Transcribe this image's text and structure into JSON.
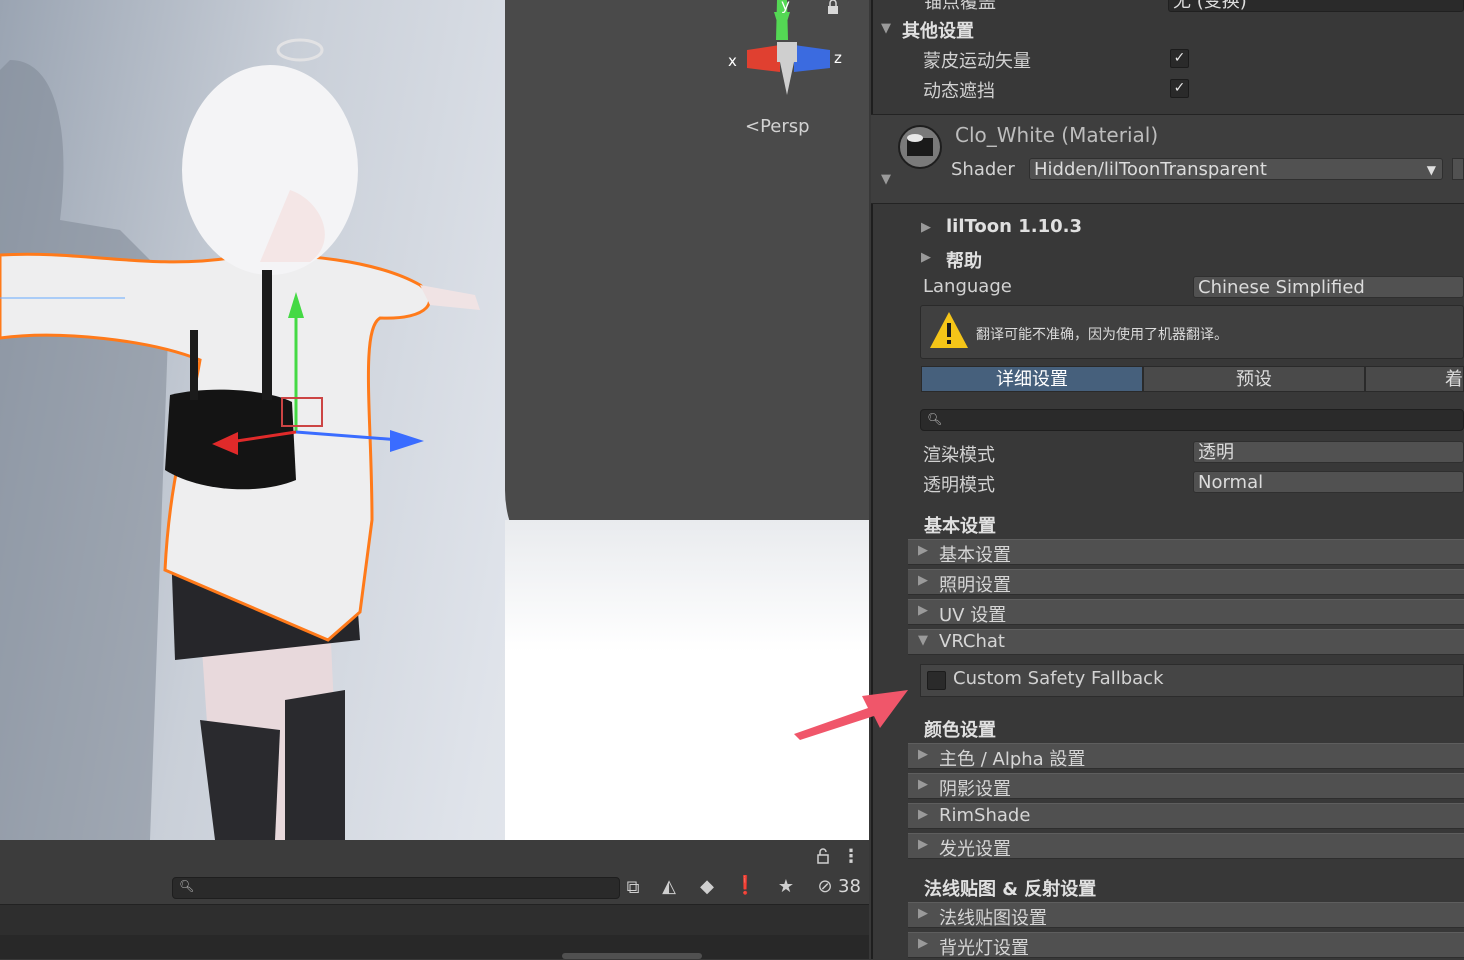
{
  "scene": {
    "persp_label": "<Persp",
    "gizmo_axes": {
      "x": "x",
      "y": "y",
      "z": "z"
    }
  },
  "project_bar": {
    "search_placeholder": "",
    "hidden_count": "38"
  },
  "inspector": {
    "top_cut_row": {
      "label": "锚点覆盖",
      "value": "无 (变换)"
    },
    "other_settings": {
      "title": "其他设置",
      "skinned_motion_vectors": "蒙皮运动矢量",
      "dynamic_occlusion": "动态遮挡"
    },
    "material": {
      "name": "Clo_White (Material)",
      "shader_label": "Shader",
      "shader_value": "Hidden/lilToonTransparent"
    },
    "liltoon_version": "lilToon 1.10.3",
    "help": "帮助",
    "language_label": "Language",
    "language_value": "Chinese Simplified",
    "warning_text": "翻译可能不准确，因为使用了机器翻译。",
    "tabs": [
      "详细设置",
      "预设",
      "着色"
    ],
    "render_mode_label": "渲染模式",
    "render_mode_value": "透明",
    "transparent_mode_label": "透明模式",
    "transparent_mode_value": "Normal",
    "basic_heading": "基本设置",
    "basic_sections": [
      "基本设置",
      "照明设置",
      "UV 设置",
      "VRChat"
    ],
    "custom_safety_fallback": "Custom Safety Fallback",
    "color_heading": "颜色设置",
    "color_sections": [
      "主色 / Alpha 設置",
      "阴影设置",
      "RimShade",
      "发光设置"
    ],
    "normal_heading": "法线贴图 & 反射设置",
    "normal_sections": [
      "法线贴图设置",
      "背光灯设置"
    ]
  },
  "colors": {
    "selection_outline": "#ff7a1a",
    "active_tab": "#46607c",
    "arrow_annotation": "#f0566a",
    "warning": "#f5c518"
  }
}
